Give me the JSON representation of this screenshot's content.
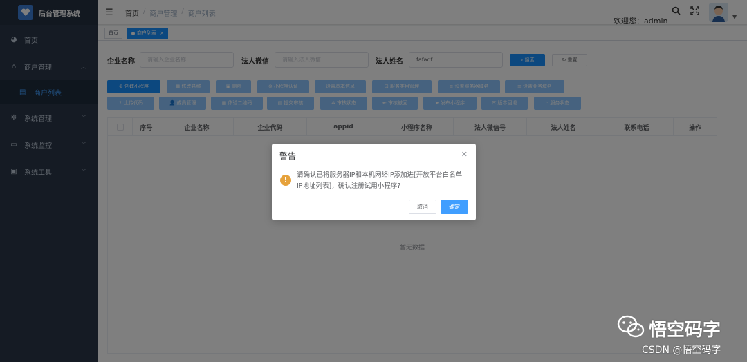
{
  "sidebar": {
    "title": "后台管理系统",
    "items": [
      {
        "label": "首页",
        "icon": "dashboard-icon"
      },
      {
        "label": "商户管理",
        "icon": "shop-icon"
      },
      {
        "label": "商户列表",
        "icon": "list-icon"
      },
      {
        "label": "系统管理",
        "icon": "gear-icon"
      },
      {
        "label": "系统监控",
        "icon": "monitor-icon"
      },
      {
        "label": "系统工具",
        "icon": "tool-icon"
      }
    ]
  },
  "header": {
    "breadcrumb": [
      "首页",
      "商户管理",
      "商户列表"
    ],
    "breadcrumb_sep": "/",
    "welcome": "欢迎您：admin"
  },
  "tags": {
    "home": "首页",
    "active": "商户列表",
    "active_close": "×"
  },
  "search": {
    "company_label": "企业名称",
    "company_placeholder": "请输入企业名称",
    "wechat_label": "法人微信",
    "wechat_placeholder": "请输入法人微信",
    "name_label": "法人姓名",
    "name_value": "fafadf",
    "search_btn": "搜索",
    "reset_btn": "重置"
  },
  "toolbar": {
    "row1": [
      "创建小程序",
      "修改名称",
      "删除",
      "小程序认证",
      "设置基本信息",
      "服务类目管理",
      "设置服务器域名",
      "设置业务域名"
    ],
    "row2": [
      "上传代码",
      "成员管理",
      "体验二维码",
      "提交审核",
      "审核状态",
      "审核撤回",
      "发布小程序",
      "版本回退",
      "服务状态"
    ]
  },
  "table": {
    "columns": [
      "序号",
      "企业名称",
      "企业代码",
      "appid",
      "小程序名称",
      "法人微信号",
      "法人姓名",
      "联系电话",
      "操作"
    ],
    "empty_text": "暂无数据"
  },
  "dialog": {
    "title": "警告",
    "message": "请确认已将服务器IP和本机网络IP添加进[开放平台白名单IP地址列表]，确认注册试用小程序?",
    "cancel": "取消",
    "confirm": "确定"
  },
  "watermark": {
    "main": "悟空码字",
    "sub": "CSDN @悟空码字"
  },
  "colors": {
    "primary": "#1890ff",
    "sidebar_bg": "#2b3648",
    "warning": "#e6a23c"
  }
}
